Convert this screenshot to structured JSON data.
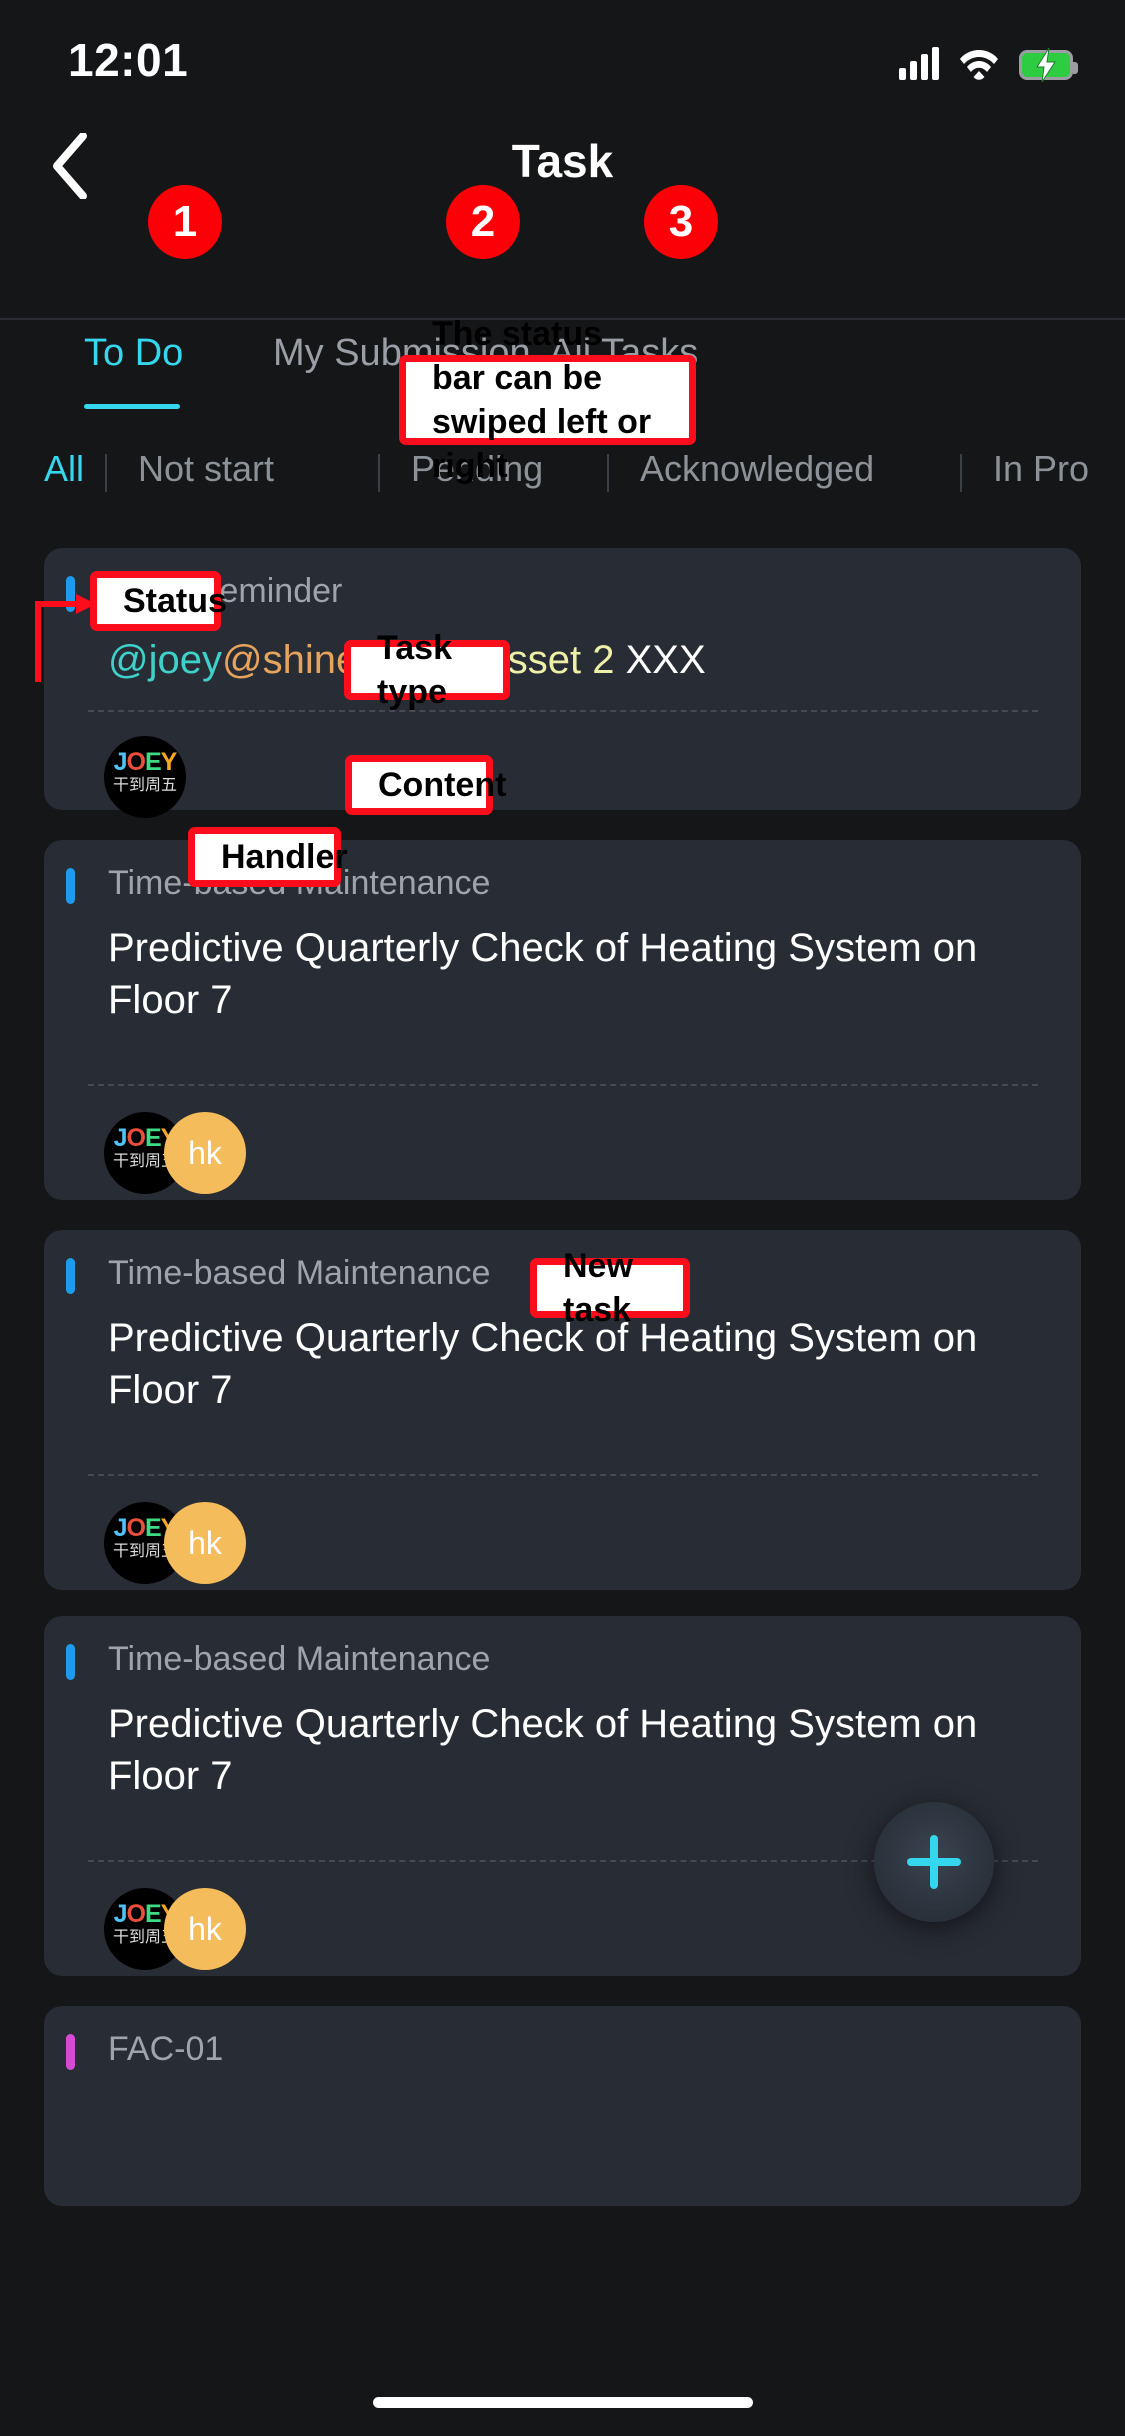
{
  "status_bar": {
    "time": "12:01",
    "icons": {
      "signal": "signal-bars-icon",
      "wifi": "wifi-icon",
      "battery": "battery-charging-icon"
    },
    "battery_color": "#2ecc40"
  },
  "header": {
    "back": "back-chevron-icon",
    "title": "Task"
  },
  "tabs": {
    "active_color": "#35D7EE",
    "items": [
      {
        "label": "To Do",
        "active": true
      },
      {
        "label": "My Submission",
        "active": false
      },
      {
        "label": "All Tasks",
        "active": false
      }
    ]
  },
  "filters": {
    "active_color": "#35D7EE",
    "items": [
      {
        "label": "All",
        "active": true
      },
      {
        "label": "Not start",
        "active": false
      },
      {
        "label": "Pending",
        "active": false
      },
      {
        "label": "Acknowledged",
        "active": false
      },
      {
        "label": "In Pro",
        "active": false
      }
    ]
  },
  "cards": [
    {
      "type": "Audit Reminder",
      "accent": "#1E9BEE",
      "mentions": [
        {
          "text": "@joey",
          "color": "#3fd0c9"
        },
        {
          "text": "@shine",
          "color": "#e6a35c"
        },
        {
          "text": "@Test Asset 2",
          "color": "#eff0a8"
        },
        {
          "text": " XXX",
          "color": "#ffffff"
        }
      ],
      "avatars": [
        {
          "kind": "joey",
          "letters": [
            "J",
            "O",
            "E",
            "Y"
          ],
          "sub": "干到周五"
        }
      ]
    },
    {
      "type": "Time-based Maintenance",
      "accent": "#1E9BEE",
      "content": "Predictive Quarterly Check of Heating System on Floor 7",
      "avatars": [
        {
          "kind": "joey",
          "letters": [
            "J",
            "O",
            "E",
            "Y"
          ],
          "sub": "干到周五"
        },
        {
          "kind": "initials",
          "label": "hk",
          "color": "#F5BC5C"
        }
      ]
    },
    {
      "type": "Time-based Maintenance",
      "accent": "#1E9BEE",
      "content": "Predictive Quarterly Check of Heating System on Floor 7",
      "avatars": [
        {
          "kind": "joey",
          "letters": [
            "J",
            "O",
            "E",
            "Y"
          ],
          "sub": "干到周五"
        },
        {
          "kind": "initials",
          "label": "hk",
          "color": "#F5BC5C"
        }
      ]
    },
    {
      "type": "Time-based Maintenance",
      "accent": "#1E9BEE",
      "content": "Predictive Quarterly Check of Heating System on Floor 7",
      "avatars": [
        {
          "kind": "joey",
          "letters": [
            "J",
            "O",
            "E",
            "Y"
          ],
          "sub": "干到周五"
        },
        {
          "kind": "initials",
          "label": "hk",
          "color": "#F5BC5C"
        }
      ]
    },
    {
      "type": "FAC-01",
      "accent": "#D64BD6",
      "content": "",
      "avatars": []
    }
  ],
  "fab": {
    "icon": "plus-icon",
    "color": "#35D7EE"
  },
  "annotations": {
    "badges": [
      "1",
      "2",
      "3"
    ],
    "callouts": [
      {
        "id": "status-bar-swipe",
        "text": "The status bar can be swiped left or right"
      },
      {
        "id": "status",
        "text": "Status"
      },
      {
        "id": "task-type",
        "text": "Task type"
      },
      {
        "id": "content",
        "text": "Content"
      },
      {
        "id": "handler",
        "text": "Handler"
      },
      {
        "id": "new-task",
        "text": "New task"
      }
    ],
    "border_color": "#FB0D1B"
  }
}
